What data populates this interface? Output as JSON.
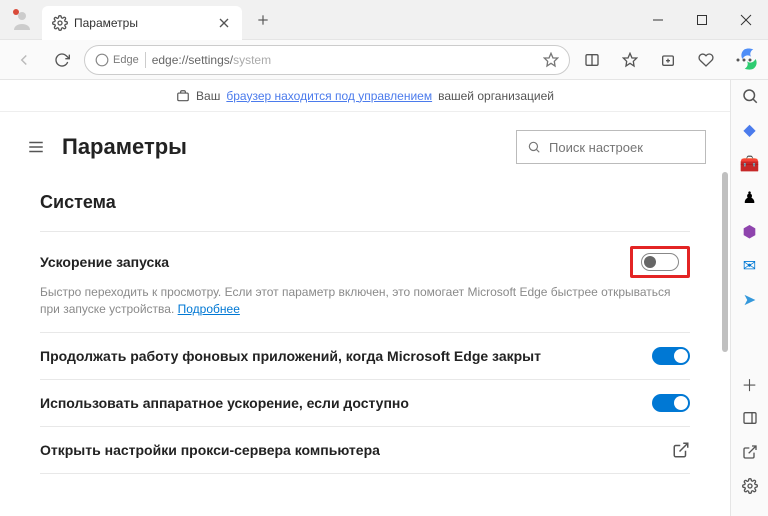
{
  "window": {
    "tab_title": "Параметры",
    "url_label": "Edge",
    "url_path_bold": "edge://settings/",
    "url_path_faded": "system"
  },
  "banner": {
    "prefix": "Ваш",
    "link": "браузер находится под управлением",
    "suffix": "вашей организацией"
  },
  "header": {
    "page_title": "Параметры",
    "search_placeholder": "Поиск настроек"
  },
  "section": {
    "title": "Система",
    "rows": [
      {
        "label": "Ускорение запуска",
        "desc_text": "Быстро переходить к просмотру. Если этот параметр включен, это помогает Microsoft Edge быстрее открываться при запуске устройства.",
        "desc_link": "Подробнее",
        "toggle": "off",
        "highlighted": true
      },
      {
        "label": "Продолжать работу фоновых приложений, когда Microsoft Edge закрыт",
        "toggle": "on"
      },
      {
        "label": "Использовать аппаратное ускорение, если доступно",
        "toggle": "on"
      },
      {
        "label": "Открыть настройки прокси-сервера компьютера",
        "action": "external"
      }
    ]
  }
}
